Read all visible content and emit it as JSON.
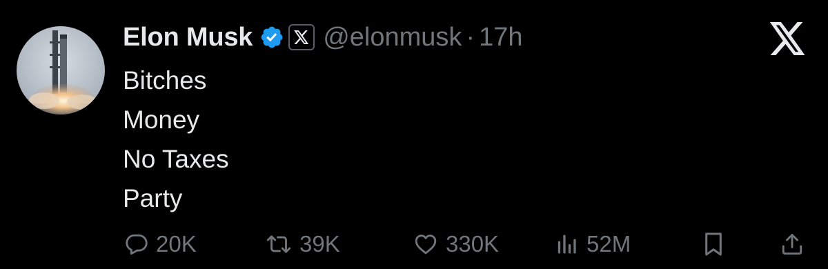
{
  "tweet": {
    "author": {
      "display_name": "Elon Musk",
      "handle": "@elonmusk",
      "verified": true,
      "affiliate_badge": "x-logo-icon",
      "avatar": "rocket-launch-avatar"
    },
    "separator": "·",
    "timestamp": "17h",
    "lines": [
      "Bitches",
      "Money",
      "No Taxes",
      "Party"
    ],
    "stats": {
      "replies": "20K",
      "reposts": "39K",
      "likes": "330K",
      "views": "52M"
    }
  },
  "brand": {
    "logo": "x-logo-icon"
  },
  "icons": {
    "reply": "reply-icon",
    "repost": "repost-icon",
    "like": "heart-icon",
    "views": "views-icon",
    "bookmark": "bookmark-icon",
    "share": "share-icon"
  },
  "colors": {
    "background": "#000000",
    "text_primary": "#e7e9ea",
    "text_secondary": "#71767b",
    "verified_blue": "#1d9bf0"
  }
}
